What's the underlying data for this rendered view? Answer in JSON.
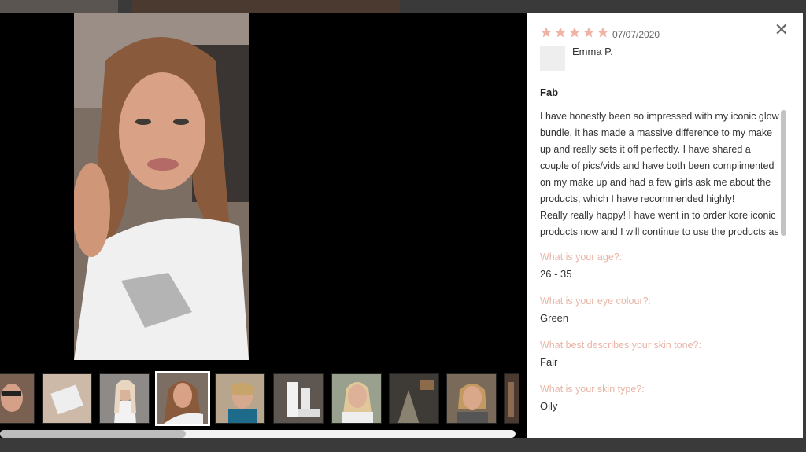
{
  "review": {
    "date": "07/07/2020",
    "rating": 5,
    "author": "Emma P.",
    "title": "Fab",
    "body": "I have honestly been so impressed with my iconic glow bundle, it has made a massive difference to my make up and really sets it off perfectly. I have shared a couple of pics/vids and have both been complimented on my make up and had a few girls ask me about the products, which I have recommended highly!\nReally really happy! I have went in to order kore iconic products now and I will continue to use the products as",
    "questions": [
      {
        "q": "What is your age?:",
        "a": "26 - 35"
      },
      {
        "q": "What is your eye colour?:",
        "a": "Green"
      },
      {
        "q": "What best describes your skin tone?:",
        "a": "Fair"
      },
      {
        "q": "What is your skin type?:",
        "a": "Oily"
      }
    ]
  },
  "colors": {
    "star": "#f0b3a6",
    "question": "#e9b4a6",
    "media_bg": "#000000"
  },
  "icons": {
    "close": "close-icon",
    "star": "star-icon"
  },
  "close_label": "✕",
  "media": {
    "thumbnail_count": 10,
    "active_thumbnail": 4
  }
}
